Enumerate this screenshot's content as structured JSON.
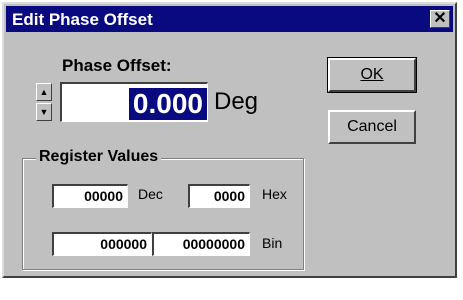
{
  "window": {
    "title": "Edit Phase Offset",
    "close_glyph": "✕"
  },
  "phase": {
    "label": "Phase Offset:",
    "value": "0.000",
    "unit": "Deg",
    "spin_up_icon": "triangle-up",
    "spin_down_icon": "triangle-down"
  },
  "buttons": {
    "ok": "OK",
    "cancel": "Cancel"
  },
  "register": {
    "title": "Register Values",
    "dec_value": "00000",
    "dec_label": "Dec",
    "hex_value": "0000",
    "hex_label": "Hex",
    "bin_high": "000000",
    "bin_low": "00000000",
    "bin_label": "Bin"
  },
  "colors": {
    "title_bar": "#0a0a80",
    "face": "#c0c0c0",
    "selection": "#0a0a80"
  }
}
